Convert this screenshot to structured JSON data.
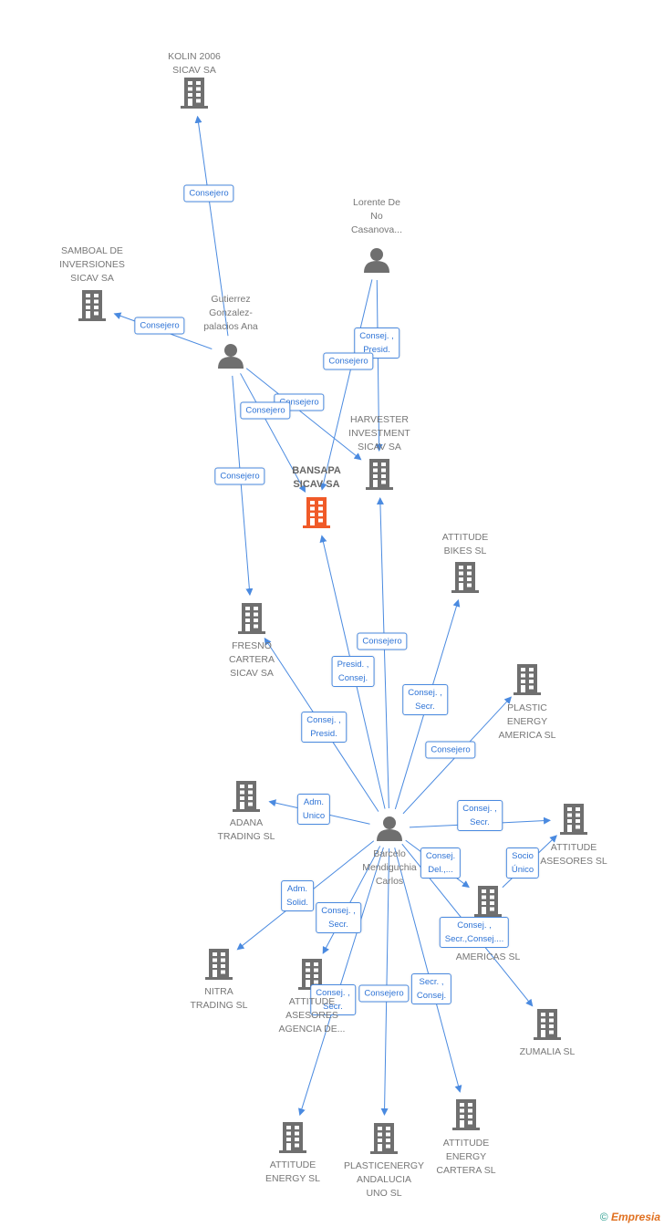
{
  "colors": {
    "edge": "#4a8ae0",
    "node": "#6f6f6f",
    "main": "#f05a28"
  },
  "nodes": [
    {
      "id": "kolin",
      "type": "company",
      "label": "KOLIN 2006\nSICAV SA"
    },
    {
      "id": "samboal",
      "type": "company",
      "label": "SAMBOAL DE\nINVERSIONES\nSICAV SA"
    },
    {
      "id": "gutierrez",
      "type": "person",
      "label": "Gutierrez\nGonzalez-\npalacios Ana"
    },
    {
      "id": "lorente",
      "type": "person",
      "label": "Lorente De\nNo\nCasanova..."
    },
    {
      "id": "harvester",
      "type": "company",
      "label": "HARVESTER\nINVESTMENT\nSICAV SA"
    },
    {
      "id": "bansapa",
      "type": "main",
      "label": "BANSAPA\nSICAV SA"
    },
    {
      "id": "bikes",
      "type": "company",
      "label": "ATTITUDE\nBIKES  SL"
    },
    {
      "id": "fresno",
      "type": "company",
      "label": "FRESNO\nCARTERA\nSICAV SA"
    },
    {
      "id": "plastic",
      "type": "company",
      "label": "PLASTIC\nENERGY\nAMERICA SL"
    },
    {
      "id": "adana",
      "type": "company",
      "label": "ADANA\nTRADING SL"
    },
    {
      "id": "barcelo",
      "type": "person",
      "label": "Barcelo\nMendiguchia\nCarlos"
    },
    {
      "id": "asesores",
      "type": "company",
      "label": "ATTITUDE\nASESORES SL"
    },
    {
      "id": "americas",
      "type": "company",
      "label": "AMERICAS SL"
    },
    {
      "id": "nitra",
      "type": "company",
      "label": "NITRA\nTRADING  SL"
    },
    {
      "id": "agencia",
      "type": "company",
      "label": "ATTITUDE\nASESORES\nAGENCIA DE..."
    },
    {
      "id": "zumalia",
      "type": "company",
      "label": "ZUMALIA  SL"
    },
    {
      "id": "energy",
      "type": "company",
      "label": "ATTITUDE\nENERGY  SL"
    },
    {
      "id": "andalucia",
      "type": "company",
      "label": "PLASTICENERGY\nANDALUCIA\nUNO SL"
    },
    {
      "id": "cartera",
      "type": "company",
      "label": "ATTITUDE\nENERGY\nCARTERA  SL"
    }
  ],
  "edges": [
    {
      "from": "gutierrez",
      "to": "kolin",
      "label": "Consejero"
    },
    {
      "from": "gutierrez",
      "to": "samboal",
      "label": "Consejero"
    },
    {
      "from": "gutierrez",
      "to": "harvester",
      "label": "Consejero"
    },
    {
      "from": "gutierrez",
      "to": "bansapa",
      "label": "Consejero"
    },
    {
      "from": "gutierrez",
      "to": "fresno",
      "label": "Consejero"
    },
    {
      "from": "lorente",
      "to": "harvester",
      "label": "Consej. ,\nPresid."
    },
    {
      "from": "lorente",
      "to": "bansapa",
      "label": "Consejero"
    },
    {
      "from": "barcelo",
      "to": "harvester",
      "label": "Consejero"
    },
    {
      "from": "barcelo",
      "to": "bansapa",
      "label": "Presid. ,\nConsej."
    },
    {
      "from": "barcelo",
      "to": "fresno",
      "label": "Consej. ,\nPresid."
    },
    {
      "from": "barcelo",
      "to": "bikes",
      "label": "Consej. ,\nSecr."
    },
    {
      "from": "barcelo",
      "to": "plastic",
      "label": "Consejero"
    },
    {
      "from": "barcelo",
      "to": "adana",
      "label": "Adm.\nUnico"
    },
    {
      "from": "barcelo",
      "to": "asesores",
      "label": "Consej. ,\nSecr."
    },
    {
      "from": "barcelo",
      "to": "americas",
      "label": "Consej.\nDel.,..."
    },
    {
      "from": "americas",
      "to": "asesores",
      "label": "Socio\nÚnico"
    },
    {
      "from": "barcelo",
      "to": "zumalia",
      "label": "Consej. ,\nSecr.,Consej...."
    },
    {
      "from": "barcelo",
      "to": "nitra",
      "label": "Adm.\nSolid."
    },
    {
      "from": "barcelo",
      "to": "agencia",
      "label": "Consej. ,\nSecr."
    },
    {
      "from": "barcelo",
      "to": "energy",
      "label": "Consej. ,\nSecr."
    },
    {
      "from": "barcelo",
      "to": "andalucia",
      "label": "Consejero"
    },
    {
      "from": "barcelo",
      "to": "cartera",
      "label": "Secr. ,\nConsej."
    }
  ],
  "footer": {
    "copyright": "©",
    "brand": "Empresia"
  }
}
